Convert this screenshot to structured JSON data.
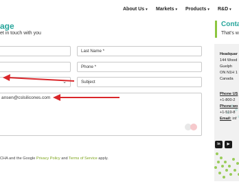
{
  "nav": {
    "items": [
      {
        "label": "About Us",
        "caret": "▾"
      },
      {
        "label": "Markets",
        "caret": "▾"
      },
      {
        "label": "Products",
        "caret": "▾"
      },
      {
        "label": "R&D",
        "caret": "▾"
      }
    ]
  },
  "form": {
    "title": "age",
    "subtitle": "et in touch with you",
    "last_name_placeholder": "Last Name *",
    "phone_placeholder": "Phone *",
    "subject_placeholder": "Subject",
    "select_chevron": "⌄",
    "email_value": "ansen@cslsilicones.com"
  },
  "footer": {
    "prefix": "CHA and the Google ",
    "privacy_link": "Privacy Policy",
    "middle": " and ",
    "terms_link": "Terms of Service",
    "suffix": " apply."
  },
  "contact": {
    "title": "Conta",
    "subtitle": "That's w",
    "hq_label": "Headquar",
    "address": [
      "144 Wood",
      "Guelph",
      "ON N1H 1",
      "Canada"
    ],
    "phone_us_label": "Phone US",
    "phone_us_value": "+1-800-2",
    "phone_world_label": "Phone wo",
    "phone_world_value": "+1-519-8",
    "email_label": "Email:",
    "email_value": " inf"
  },
  "social": {
    "linkedin": "in",
    "youtube": "▶"
  },
  "colors": {
    "accent_teal": "#27a59b",
    "accent_green": "#8cc63f",
    "link_green": "#7ba31a",
    "annotation_arrow": "#d9262a"
  }
}
